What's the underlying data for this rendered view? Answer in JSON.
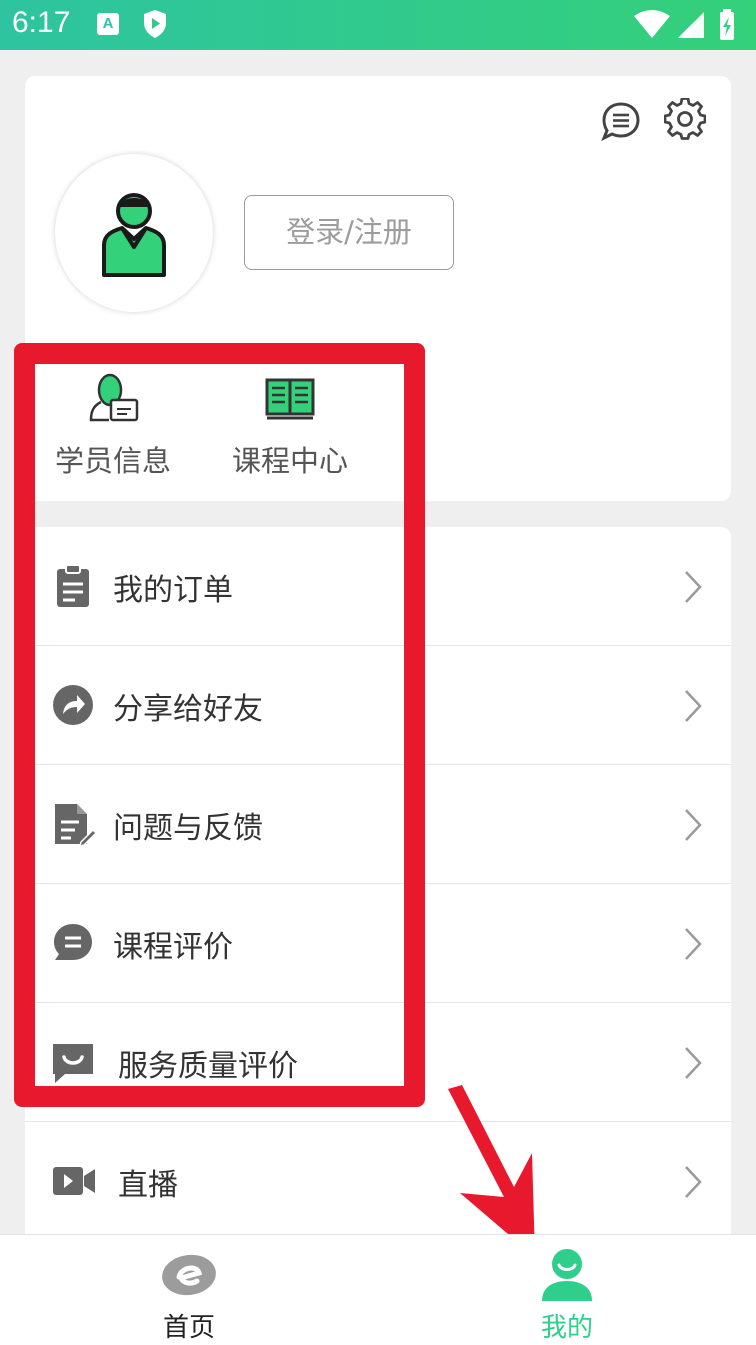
{
  "status_bar": {
    "time": "6:17",
    "a_badge": "A"
  },
  "profile": {
    "login_label": "登录/注册",
    "quick_items": [
      {
        "label": "学员信息",
        "icon": "student-info-icon"
      },
      {
        "label": "课程中心",
        "icon": "book-icon"
      }
    ]
  },
  "menu": {
    "items": [
      {
        "label": "我的订单",
        "icon": "clipboard-icon"
      },
      {
        "label": "分享给好友",
        "icon": "share-icon"
      },
      {
        "label": "问题与反馈",
        "icon": "feedback-doc-icon"
      },
      {
        "label": "课程评价",
        "icon": "comment-icon"
      },
      {
        "label": "服务质量评价",
        "icon": "smile-chat-icon"
      },
      {
        "label": "直播",
        "icon": "video-camera-icon"
      }
    ]
  },
  "bottom_nav": {
    "items": [
      {
        "label": "首页",
        "icon": "e-logo-icon",
        "active": false
      },
      {
        "label": "我的",
        "icon": "user-icon",
        "active": true
      }
    ]
  },
  "colors": {
    "accent": "#2ecf8b",
    "highlight": "#e8192c",
    "icon_gray": "#666666"
  }
}
